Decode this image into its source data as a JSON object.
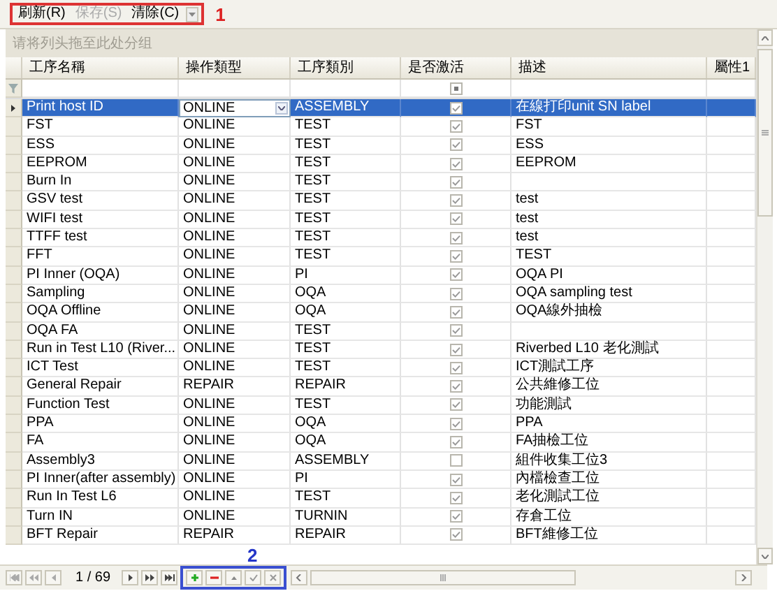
{
  "toolbar": {
    "buttons": [
      {
        "label": "刷新(R)",
        "disabled": false
      },
      {
        "label": "保存(S)",
        "disabled": true
      },
      {
        "label": "清除(C)",
        "disabled": false
      }
    ],
    "callout": "1"
  },
  "group_panel": {
    "hint": "请将列头拖至此处分组"
  },
  "grid": {
    "columns": [
      "工序名稱",
      "操作類型",
      "工序類別",
      "是否激活",
      "描述",
      "屬性1"
    ],
    "filter_row": {
      "active_indeterminate": true
    },
    "rows": [
      {
        "name": "Print host ID",
        "op_type": "ONLINE",
        "category": "ASSEMBLY",
        "active": true,
        "description": "在線打印unit SN label",
        "selected": true
      },
      {
        "name": "FST",
        "op_type": "ONLINE",
        "category": "TEST",
        "active": true,
        "description": "FST",
        "selected": false
      },
      {
        "name": "ESS",
        "op_type": "ONLINE",
        "category": "TEST",
        "active": true,
        "description": "ESS",
        "selected": false
      },
      {
        "name": "EEPROM",
        "op_type": "ONLINE",
        "category": "TEST",
        "active": true,
        "description": "EEPROM",
        "selected": false
      },
      {
        "name": "Burn In",
        "op_type": "ONLINE",
        "category": "TEST",
        "active": true,
        "selected": false
      },
      {
        "name": "GSV test",
        "op_type": "ONLINE",
        "category": "TEST",
        "active": true,
        "description": "test",
        "selected": false
      },
      {
        "name": "WIFI test",
        "op_type": "ONLINE",
        "category": "TEST",
        "active": true,
        "description": "test",
        "selected": false
      },
      {
        "name": "TTFF test",
        "op_type": "ONLINE",
        "category": "TEST",
        "active": true,
        "description": "test",
        "selected": false
      },
      {
        "name": "FFT",
        "op_type": "ONLINE",
        "category": "TEST",
        "active": true,
        "description": "TEST",
        "selected": false
      },
      {
        "name": "PI Inner (OQA)",
        "op_type": "ONLINE",
        "category": "PI",
        "active": true,
        "description": "OQA PI",
        "selected": false
      },
      {
        "name": "Sampling",
        "op_type": "ONLINE",
        "category": "OQA",
        "active": true,
        "description": "OQA sampling test",
        "selected": false
      },
      {
        "name": "OQA Offline",
        "op_type": "ONLINE",
        "category": "OQA",
        "active": true,
        "description": "OQA線外抽檢",
        "selected": false
      },
      {
        "name": "OQA FA",
        "op_type": "ONLINE",
        "category": "TEST",
        "active": true,
        "selected": false
      },
      {
        "name": "Run in Test L10 (River...",
        "op_type": "ONLINE",
        "category": "TEST",
        "active": true,
        "description": "Riverbed L10 老化測試",
        "selected": false
      },
      {
        "name": "ICT Test",
        "op_type": "ONLINE",
        "category": "TEST",
        "active": true,
        "description": "ICT測試工序",
        "selected": false
      },
      {
        "name": "General Repair",
        "op_type": "REPAIR",
        "category": "REPAIR",
        "active": true,
        "description": "公共維修工位",
        "selected": false
      },
      {
        "name": "Function Test",
        "op_type": "ONLINE",
        "category": "TEST",
        "active": true,
        "description": "功能測試",
        "selected": false
      },
      {
        "name": "PPA",
        "op_type": "ONLINE",
        "category": "OQA",
        "active": true,
        "description": "PPA",
        "selected": false
      },
      {
        "name": "FA",
        "op_type": "ONLINE",
        "category": "OQA",
        "active": true,
        "description": "FA抽檢工位",
        "selected": false
      },
      {
        "name": "Assembly3",
        "op_type": "ONLINE",
        "category": "ASSEMBLY",
        "active": false,
        "description": "組件收集工位3",
        "selected": false
      },
      {
        "name": "PI Inner(after assembly)",
        "op_type": "ONLINE",
        "category": "PI",
        "active": true,
        "description": "內檔檢查工位",
        "selected": false
      },
      {
        "name": "Run In Test L6",
        "op_type": "ONLINE",
        "category": "TEST",
        "active": true,
        "description": "老化測試工位",
        "selected": false
      },
      {
        "name": "Turn IN",
        "op_type": "ONLINE",
        "category": "TURNIN",
        "active": true,
        "description": "存倉工位",
        "selected": false
      },
      {
        "name": "BFT Repair",
        "op_type": "REPAIR",
        "category": "REPAIR",
        "active": true,
        "description": "BFT維修工位",
        "selected": false
      }
    ]
  },
  "pager": {
    "position": "1 / 69",
    "callout": "2"
  }
}
